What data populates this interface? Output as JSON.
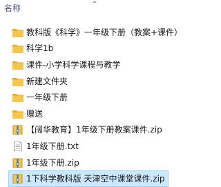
{
  "header": {
    "column_name": "名称"
  },
  "items": [
    {
      "name": "教科版《科学》一年级下册（教案+课件）",
      "type": "folder"
    },
    {
      "name": "科学1b",
      "type": "folder"
    },
    {
      "name": "课件-小学科学课程与教学",
      "type": "folder"
    },
    {
      "name": "新建文件夹",
      "type": "folder"
    },
    {
      "name": "一年级下册",
      "type": "folder"
    },
    {
      "name": "赠送",
      "type": "folder"
    },
    {
      "name": "【阔华教育】1年级下册教案课件.zip",
      "type": "zip"
    },
    {
      "name": "1年级下册.txt",
      "type": "txt"
    },
    {
      "name": "1年级下册.zip",
      "type": "zip"
    },
    {
      "name": "1下科学教科版 天津空中课堂课件.zip",
      "type": "zip",
      "selected": true
    }
  ],
  "colors": {
    "folder": "#f3c64d",
    "folder_dark": "#e0a92b",
    "selection_bg": "#cce8ff",
    "selection_border": "#99d1ff",
    "header_text": "#4c607a"
  }
}
